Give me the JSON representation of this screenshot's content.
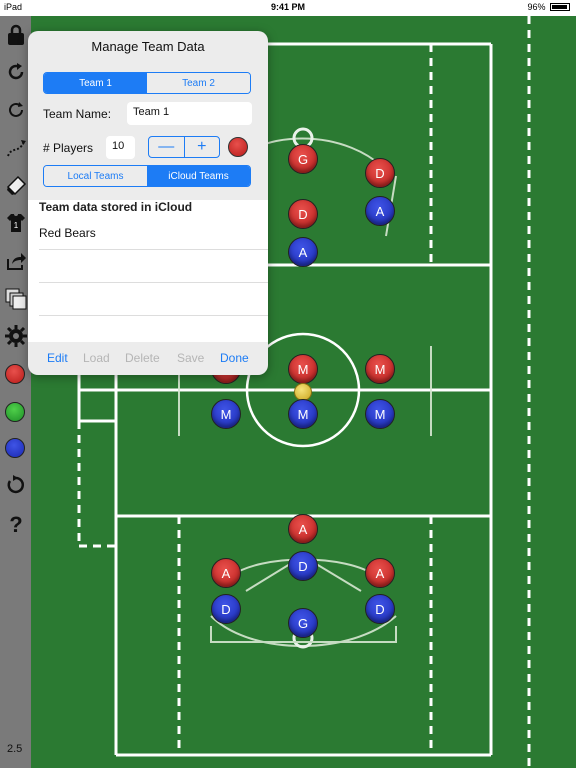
{
  "status_bar": {
    "device": "iPad",
    "time": "9:41 PM",
    "battery": "96%"
  },
  "app": {
    "version": "2.5"
  },
  "toolbar": {
    "icons": [
      "lock-icon",
      "rotate-icon",
      "refresh-icon",
      "draw-path-icon",
      "eraser-icon",
      "jersey-icon",
      "share-icon",
      "layers-icon",
      "gear-icon",
      "red-dot",
      "green-dot",
      "blue-dot",
      "cycle-icon",
      "help-icon"
    ],
    "colors": {
      "red": "#d33a36",
      "green": "#2fb23a",
      "blue": "#2434c9"
    }
  },
  "dialog": {
    "title": "Manage Team Data",
    "team_tabs": [
      "Team 1",
      "Team 2"
    ],
    "team_name_label": "Team Name:",
    "team_name_value": "Team 1",
    "players_label": "# Players",
    "players_value": "10",
    "stepper_minus": "—",
    "stepper_plus": "+",
    "source_tabs": [
      "Local Teams",
      "iCloud Teams"
    ],
    "list_header": "Team data stored in iCloud",
    "list_items": [
      "Red Bears",
      "",
      "",
      ""
    ],
    "actions": [
      "Edit",
      "Load",
      "Delete",
      "Save",
      "Done"
    ]
  },
  "field": {
    "players": [
      {
        "label": "G",
        "team": "red"
      },
      {
        "label": "D",
        "team": "red"
      },
      {
        "label": "D",
        "team": "red"
      },
      {
        "label": "A",
        "team": "blue"
      },
      {
        "label": "A",
        "team": "blue"
      },
      {
        "label": "M",
        "team": "red"
      },
      {
        "label": "M",
        "team": "red"
      },
      {
        "label": "M",
        "team": "red"
      },
      {
        "label": "M",
        "team": "blue"
      },
      {
        "label": "M",
        "team": "blue"
      },
      {
        "label": "M",
        "team": "blue"
      },
      {
        "label": "A",
        "team": "red"
      },
      {
        "label": "A",
        "team": "red"
      },
      {
        "label": "A",
        "team": "red"
      },
      {
        "label": "D",
        "team": "blue"
      },
      {
        "label": "D",
        "team": "blue"
      },
      {
        "label": "D",
        "team": "blue"
      },
      {
        "label": "G",
        "team": "blue"
      }
    ]
  }
}
